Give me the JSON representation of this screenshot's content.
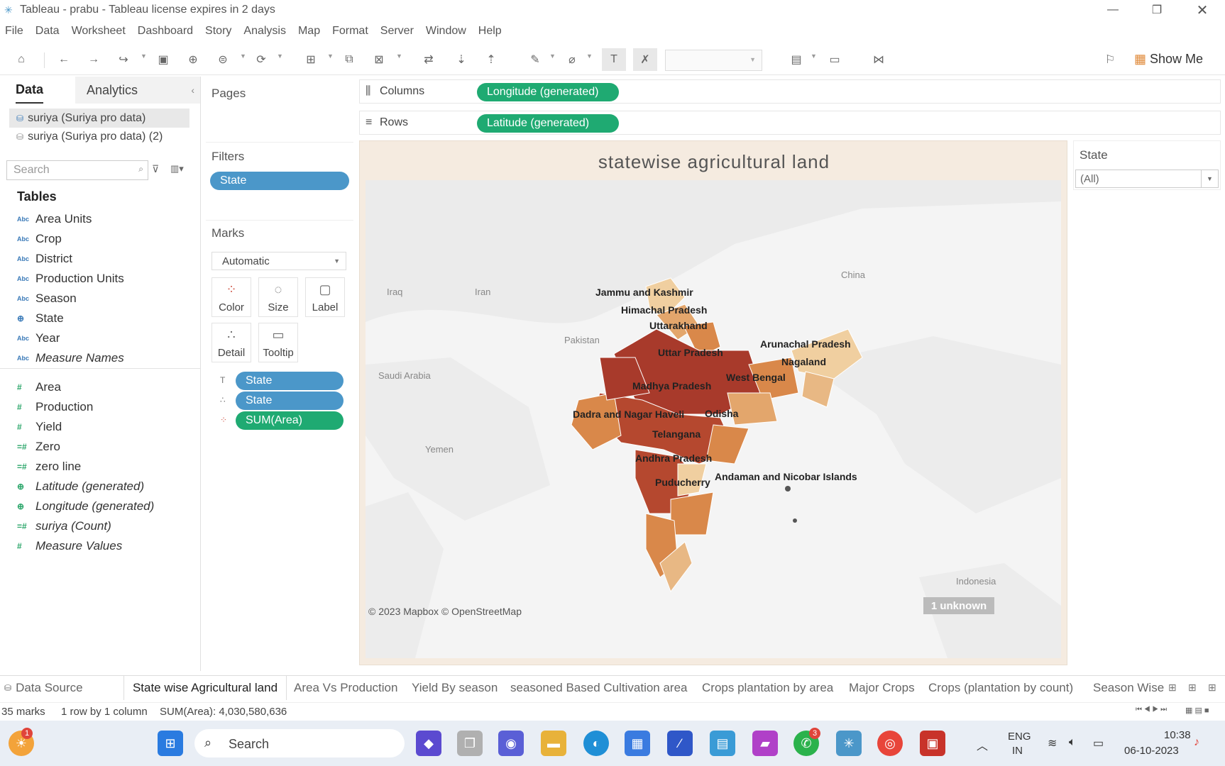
{
  "window": {
    "title": "Tableau - prabu - Tableau license expires in 2 days"
  },
  "menu": [
    "File",
    "Data",
    "Worksheet",
    "Dashboard",
    "Story",
    "Analysis",
    "Map",
    "Format",
    "Server",
    "Window",
    "Help"
  ],
  "toolbar": {
    "show_me": "Show Me"
  },
  "data_pane": {
    "tabs": {
      "data": "Data",
      "analytics": "Analytics"
    },
    "sources": [
      "suriya (Suriya pro data)",
      "suriya (Suriya pro data) (2)"
    ],
    "search_placeholder": "Search",
    "tables_heading": "Tables",
    "dimensions": [
      {
        "type": "Abc",
        "label": "Area Units"
      },
      {
        "type": "Abc",
        "label": "Crop"
      },
      {
        "type": "Abc",
        "label": "District"
      },
      {
        "type": "Abc",
        "label": "Production Units"
      },
      {
        "type": "Abc",
        "label": "Season"
      },
      {
        "type": "geo",
        "label": "State"
      },
      {
        "type": "Abc",
        "label": "Year"
      },
      {
        "type": "Abc",
        "label": "Measure Names"
      }
    ],
    "measures": [
      {
        "label": "Area"
      },
      {
        "label": "Production"
      },
      {
        "label": "Yield"
      },
      {
        "label": "Zero"
      },
      {
        "label": "zero line"
      },
      {
        "label": "Latitude (generated)"
      },
      {
        "label": "Longitude (generated)"
      },
      {
        "label": "suriya (Count)"
      },
      {
        "label": "Measure Values"
      }
    ]
  },
  "pages": {
    "title": "Pages"
  },
  "filters": {
    "title": "Filters",
    "pills": [
      "State"
    ]
  },
  "marks": {
    "title": "Marks",
    "type": "Automatic",
    "buttons": [
      "Color",
      "Size",
      "Label",
      "Detail",
      "Tooltip"
    ],
    "pills": [
      "State",
      "State",
      "SUM(Area)"
    ]
  },
  "shelves": {
    "columns_label": "Columns",
    "columns_pill": "Longitude (generated)",
    "rows_label": "Rows",
    "rows_pill": "Latitude (generated)"
  },
  "view": {
    "title": "statewise agricultural land",
    "labels": [
      "Jammu and Kashmir",
      "Himachal Pradesh",
      "Uttarakhand",
      "Uttar Pradesh",
      "Arunachal Pradesh",
      "Nagaland",
      "West Bengal",
      "Madhya Pradesh",
      "Dadra and Nagar Haveli",
      "Odisha",
      "Telangana",
      "Andhra Pradesh",
      "Puducherry",
      "Andaman and Nicobar Islands"
    ],
    "geo_labels": [
      "Iraq",
      "Iran",
      "Pakistan",
      "China",
      "Saudi Arabia",
      "Yemen",
      "Indonesia"
    ],
    "attribution": "© 2023 Mapbox © OpenStreetMap",
    "unknown": "1 unknown"
  },
  "state_filter": {
    "title": "State",
    "value": "(All)"
  },
  "sheet_tabs": [
    "Data Source",
    "State wise Agricultural land",
    "Area Vs Production",
    "Yield By season",
    "seasoned Based Cultivation area",
    "Crops plantation by area",
    "Major Crops",
    "Crops (plantation by count)",
    "Season Wise"
  ],
  "status": {
    "marks": "35 marks",
    "layout": "1 row by 1 column",
    "sum": "SUM(Area): 4,030,580,636"
  },
  "taskbar": {
    "search": "Search",
    "lang1": "ENG",
    "lang2": "IN",
    "time": "10:38",
    "date": "06-10-2023",
    "whatsapp_badge": "3",
    "weather_badge": "1"
  },
  "colors": {
    "accent_blue": "#4b97c9",
    "accent_green": "#1faa72",
    "dark": "#a83a2b",
    "mid": "#d9884a",
    "light": "#f0cfa0"
  }
}
